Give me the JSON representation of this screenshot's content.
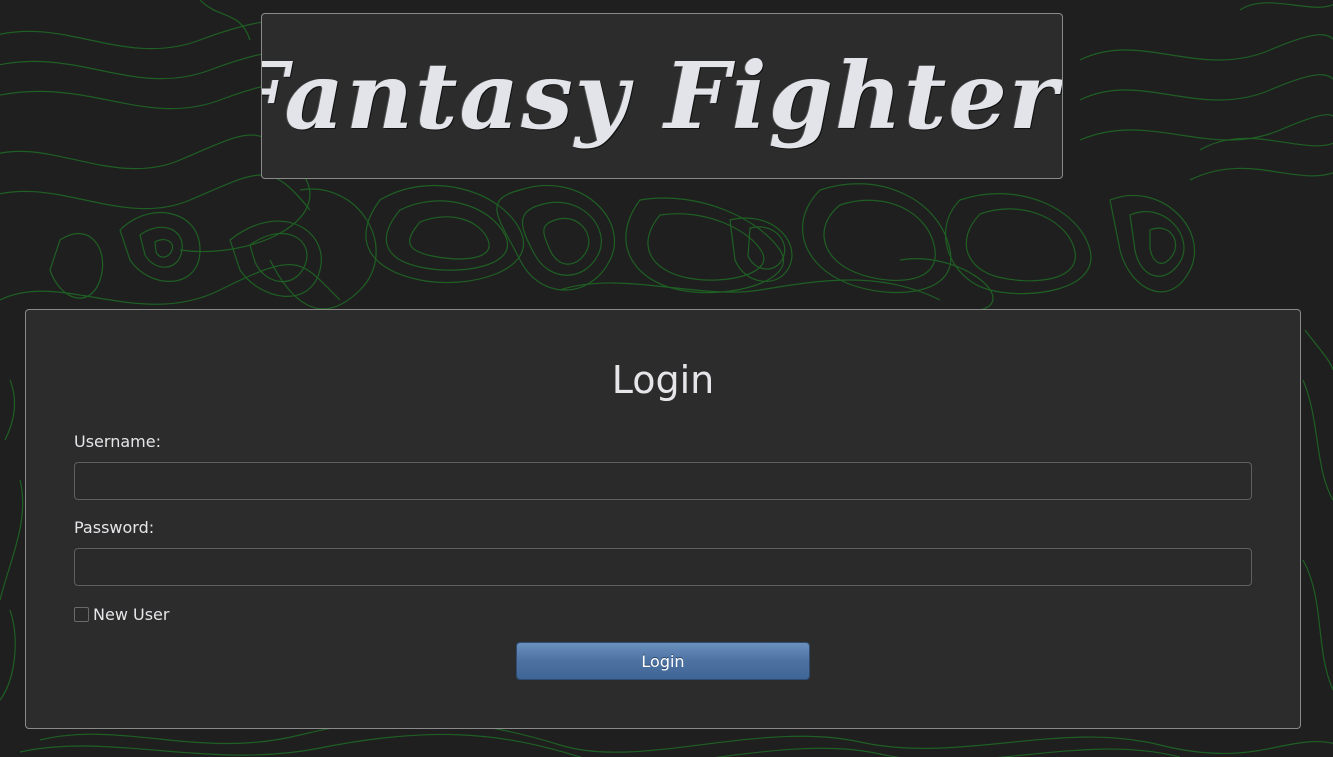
{
  "app": {
    "title": "Fantasy Fighter!"
  },
  "login_form": {
    "heading": "Login",
    "username_label": "Username:",
    "username_value": "",
    "password_label": "Password:",
    "password_value": "",
    "new_user_label": "New User",
    "new_user_checked": false,
    "submit_label": "Login"
  },
  "theme": {
    "background": "#1f1f20",
    "contour_lines": "#1f6b24",
    "panel": "#2c2c2c",
    "panel_border": "#8a8a8a",
    "text": "#e6e6ea",
    "button_accent": "#4e73a3"
  }
}
